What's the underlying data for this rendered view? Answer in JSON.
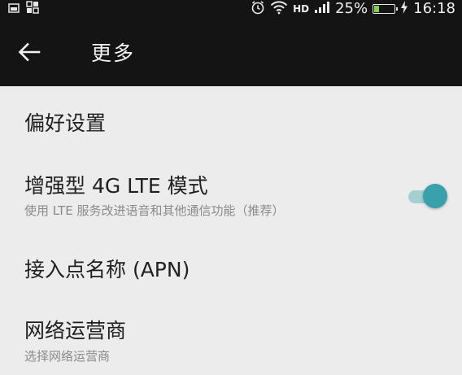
{
  "status_bar": {
    "hd_label": "HD",
    "battery_percent": "25%",
    "battery_level": 0.25,
    "time": "16:18",
    "icons": [
      "image-icon",
      "grid-icon",
      "alarm-icon",
      "wifi-icon",
      "signal-icon",
      "battery-icon",
      "charging-icon"
    ]
  },
  "app_bar": {
    "title": "更多",
    "back_icon": "back-arrow-icon"
  },
  "settings": {
    "preferences": {
      "title": "偏好设置"
    },
    "lte_mode": {
      "title": "增强型 4G LTE 模式",
      "subtitle": "使用 LTE 服务改进语音和其他通信功能（推荐）",
      "enabled": true,
      "accent_color": "#39a1ab"
    },
    "apn": {
      "title": "接入点名称 (APN)"
    },
    "network_operator": {
      "title": "网络运营商",
      "subtitle": "选择网络运营商"
    }
  }
}
